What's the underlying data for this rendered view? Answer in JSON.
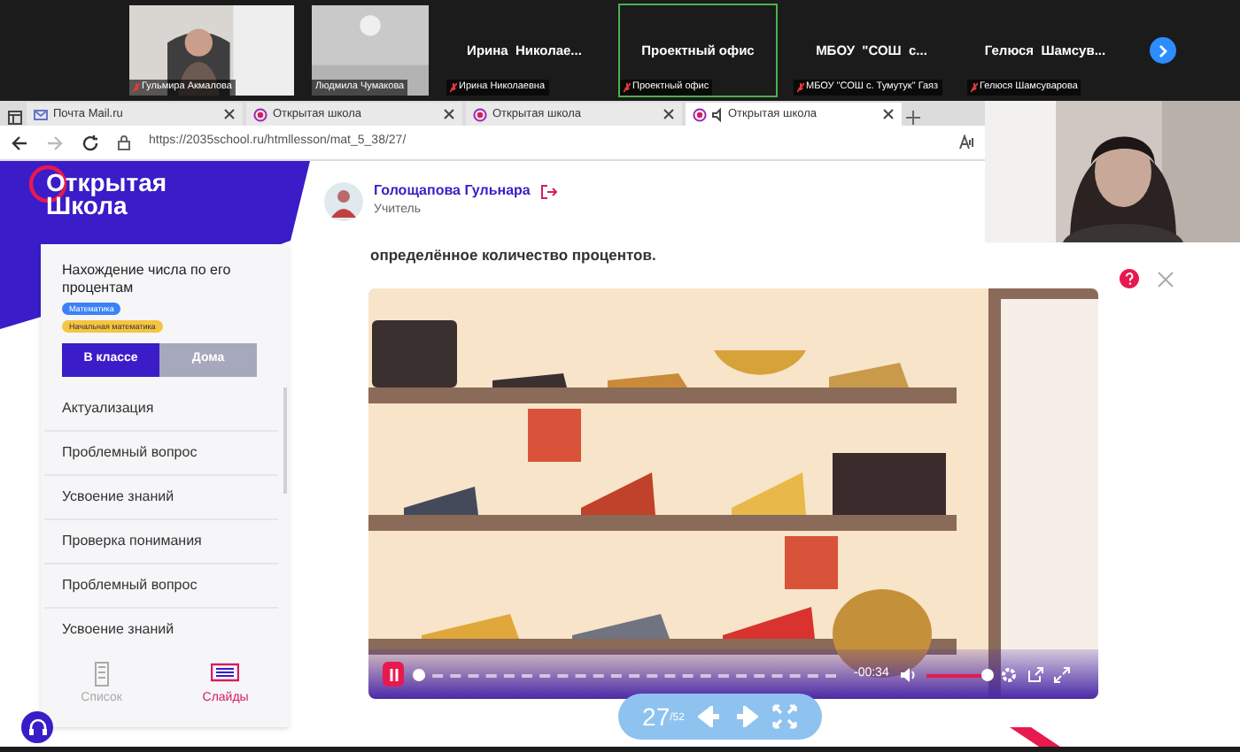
{
  "participants": [
    {
      "kind": "camera",
      "name": "Гульмира Акмалова",
      "muted": true,
      "speaking": false
    },
    {
      "kind": "camera",
      "name": "Людмила Чумакова",
      "muted": false,
      "speaking": false
    },
    {
      "kind": "text",
      "title": "Ирина  Николае...",
      "name": "Ирина Николаевна",
      "muted": true,
      "speaking": false
    },
    {
      "kind": "text",
      "title": "Проектный офис",
      "name": "Проектный офис",
      "muted": true,
      "speaking": true
    },
    {
      "kind": "text",
      "title": "МБОУ  \"СОШ  с...",
      "name": "МБОУ \"СОШ с. Тумутук\" Гаяз",
      "muted": true,
      "speaking": false
    },
    {
      "kind": "text",
      "title": "Гелюся  Шамсув...",
      "name": "Гелюся Шамсуварова",
      "muted": true,
      "speaking": false
    }
  ],
  "browser": {
    "tabs": [
      {
        "kind": "mail",
        "title": "Почта Mail.ru",
        "selected": false,
        "audio": false
      },
      {
        "kind": "school",
        "title": "Открытая школа",
        "selected": false,
        "audio": false
      },
      {
        "kind": "school",
        "title": "Открытая школа",
        "selected": false,
        "audio": false
      },
      {
        "kind": "school",
        "title": "Открытая школа",
        "selected": true,
        "audio": true
      }
    ],
    "url": "https://2035school.ru/htmllesson/mat_5_38/27/"
  },
  "page": {
    "logo": [
      "Открытая",
      "Школа"
    ],
    "user": {
      "name": "Голощапова Гульнара",
      "role": "Учитель"
    },
    "lesson": {
      "title": "Нахождение числа по его процентам",
      "tags": [
        {
          "label": "Математика",
          "color": "#3b82f6"
        },
        {
          "label": "Начальная математика",
          "color": "#f5c542"
        }
      ],
      "modes": [
        {
          "label": "В классе",
          "selected": true
        },
        {
          "label": "Дома",
          "selected": false
        }
      ],
      "sections": [
        "Актуализация",
        "Проблемный вопрос",
        "Усвоение знаний",
        "Проверка понимания",
        "Проблемный вопрос",
        "Усвоение знаний"
      ],
      "views": [
        {
          "kind": "list",
          "label": "Список",
          "selected": false
        },
        {
          "kind": "slides",
          "label": "Слайды",
          "selected": true
        }
      ]
    },
    "content_text": "определённое количество процентов.",
    "video": {
      "kind": "picture",
      "time": "-00:34",
      "progress": {
        "level": 0.01
      },
      "volume": {
        "level": 0.95
      }
    },
    "slide_nav": {
      "current": "27",
      "total": "/52"
    }
  }
}
